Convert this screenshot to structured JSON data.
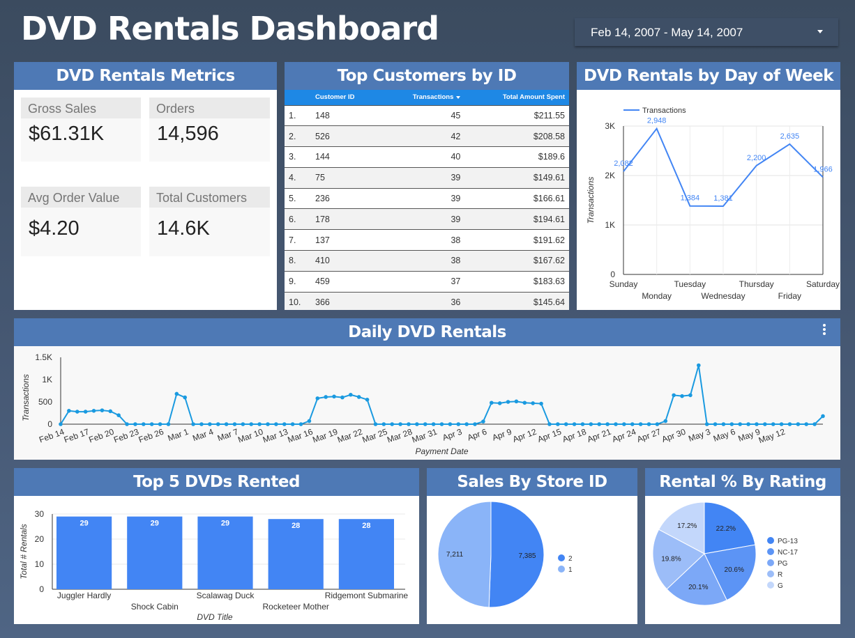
{
  "header": {
    "title": "DVD Rentals Dashboard",
    "date_range": "Feb 14, 2007 - May 14, 2007"
  },
  "metrics": {
    "title": "DVD Rentals Metrics",
    "items": [
      {
        "label": "Gross Sales",
        "value": "$61.31K"
      },
      {
        "label": "Orders",
        "value": "14,596"
      },
      {
        "label": "Avg Order Value",
        "value": "$4.20"
      },
      {
        "label": "Total Customers",
        "value": "14.6K"
      }
    ]
  },
  "top_customers": {
    "title": "Top Customers by ID",
    "columns": [
      "",
      "Customer ID",
      "Transactions",
      "Total Amount Spent"
    ],
    "rows": [
      [
        "1.",
        "148",
        "45",
        "$211.55"
      ],
      [
        "2.",
        "526",
        "42",
        "$208.58"
      ],
      [
        "3.",
        "144",
        "40",
        "$189.6"
      ],
      [
        "4.",
        "75",
        "39",
        "$149.61"
      ],
      [
        "5.",
        "236",
        "39",
        "$166.61"
      ],
      [
        "6.",
        "178",
        "39",
        "$194.61"
      ],
      [
        "7.",
        "137",
        "38",
        "$191.62"
      ],
      [
        "8.",
        "410",
        "38",
        "$167.62"
      ],
      [
        "9.",
        "459",
        "37",
        "$183.63"
      ],
      [
        "10.",
        "366",
        "36",
        "$145.64"
      ]
    ]
  },
  "panels": {
    "day_of_week_title": "DVD Rentals by Day of Week",
    "daily_title": "Daily DVD Rentals",
    "top5_title": "Top 5 DVDs Rented",
    "store_title": "Sales By Store ID",
    "rating_title": "Rental % By Rating"
  },
  "colors": {
    "accent": "#4e79b5",
    "series": "#4285f4",
    "daily_series": "#1a9ae0"
  },
  "chart_data": [
    {
      "type": "line",
      "id": "day_of_week",
      "categories": [
        "Sunday",
        "Monday",
        "Tuesday",
        "Wednesday",
        "Thursday",
        "Friday",
        "Saturday"
      ],
      "series": [
        {
          "name": "Transactions",
          "values": [
            2082,
            2948,
            1384,
            1381,
            2200,
            2635,
            1966
          ]
        }
      ],
      "data_labels": [
        "2,082",
        "2,948",
        "1,384",
        "1,381",
        "2,200",
        "2,635",
        "1,966"
      ],
      "ylabel": "Transactions",
      "ylim": [
        0,
        3000
      ],
      "yticks": [
        "0",
        "1K",
        "2K",
        "3K"
      ],
      "legend": "top-left",
      "grid": true
    },
    {
      "type": "line",
      "id": "daily",
      "xlabel": "Payment Date",
      "ylabel": "Transactions",
      "ylim": [
        0,
        1500
      ],
      "yticks": [
        "0",
        "500",
        "1K",
        "1.5K"
      ],
      "xticks": [
        "Feb 14",
        "Feb 17",
        "Feb 20",
        "Feb 23",
        "Feb 26",
        "Mar 1",
        "Mar 4",
        "Mar 7",
        "Mar 10",
        "Mar 13",
        "Mar 16",
        "Mar 19",
        "Mar 22",
        "Mar 25",
        "Mar 28",
        "Mar 31",
        "Apr 3",
        "Apr 6",
        "Apr 9",
        "Apr 12",
        "Apr 15",
        "Apr 18",
        "Apr 21",
        "Apr 24",
        "Apr 27",
        "Apr 30",
        "May 3",
        "May 6",
        "May 9",
        "May 12"
      ],
      "x_start": "Feb 14",
      "values": [
        0,
        300,
        280,
        280,
        300,
        310,
        290,
        200,
        0,
        0,
        0,
        0,
        0,
        0,
        680,
        600,
        0,
        0,
        0,
        0,
        0,
        0,
        0,
        0,
        0,
        0,
        0,
        0,
        0,
        0,
        70,
        580,
        610,
        620,
        600,
        660,
        610,
        550,
        0,
        0,
        0,
        0,
        0,
        0,
        0,
        0,
        0,
        0,
        0,
        0,
        0,
        60,
        480,
        470,
        500,
        510,
        480,
        470,
        460,
        0,
        0,
        0,
        0,
        0,
        0,
        0,
        0,
        0,
        0,
        0,
        0,
        0,
        0,
        70,
        650,
        630,
        650,
        1320,
        0,
        0,
        0,
        0,
        0,
        0,
        0,
        0,
        0,
        0,
        0,
        0,
        0,
        0,
        180
      ]
    },
    {
      "type": "bar",
      "id": "top5",
      "categories": [
        "Juggler Hardly",
        "Shock Cabin",
        "Scalawag Duck",
        "Rocketeer Mother",
        "Ridgemont Submarine"
      ],
      "values": [
        29,
        29,
        29,
        28,
        28
      ],
      "xlabel": "DVD Title",
      "ylabel": "Total # Rentals",
      "ylim": [
        0,
        30
      ],
      "yticks": [
        "0",
        "10",
        "20",
        "30"
      ]
    },
    {
      "type": "pie",
      "id": "store",
      "labels": [
        "2",
        "1"
      ],
      "values": [
        7385,
        7211
      ],
      "data_labels": [
        "7,385",
        "7,211"
      ],
      "colors": [
        "#4285f4",
        "#8ab4f8"
      ],
      "legend": "right"
    },
    {
      "type": "pie",
      "id": "rating",
      "labels": [
        "PG-13",
        "NC-17",
        "PG",
        "R",
        "G"
      ],
      "values": [
        22.2,
        20.6,
        20.1,
        19.8,
        17.2
      ],
      "data_labels": [
        "22.2%",
        "20.6%",
        "20.1%",
        "19.8%",
        "17.2%"
      ],
      "colors": [
        "#4285f4",
        "#5c94f5",
        "#7ca8f7",
        "#9cbdf8",
        "#c3d7fb"
      ],
      "legend": "right"
    }
  ]
}
